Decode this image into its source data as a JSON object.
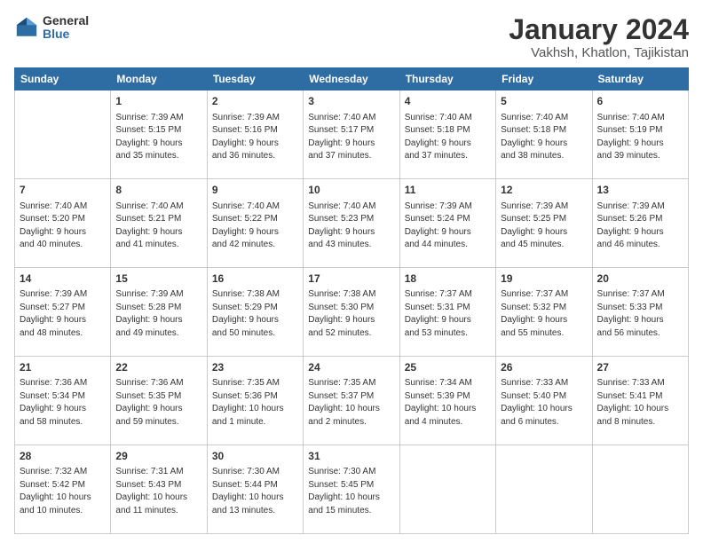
{
  "logo": {
    "general": "General",
    "blue": "Blue"
  },
  "header": {
    "title": "January 2024",
    "subtitle": "Vakhsh, Khatlon, Tajikistan"
  },
  "weekdays": [
    "Sunday",
    "Monday",
    "Tuesday",
    "Wednesday",
    "Thursday",
    "Friday",
    "Saturday"
  ],
  "weeks": [
    [
      {
        "day": "",
        "info": ""
      },
      {
        "day": "1",
        "info": "Sunrise: 7:39 AM\nSunset: 5:15 PM\nDaylight: 9 hours\nand 35 minutes."
      },
      {
        "day": "2",
        "info": "Sunrise: 7:39 AM\nSunset: 5:16 PM\nDaylight: 9 hours\nand 36 minutes."
      },
      {
        "day": "3",
        "info": "Sunrise: 7:40 AM\nSunset: 5:17 PM\nDaylight: 9 hours\nand 37 minutes."
      },
      {
        "day": "4",
        "info": "Sunrise: 7:40 AM\nSunset: 5:18 PM\nDaylight: 9 hours\nand 37 minutes."
      },
      {
        "day": "5",
        "info": "Sunrise: 7:40 AM\nSunset: 5:18 PM\nDaylight: 9 hours\nand 38 minutes."
      },
      {
        "day": "6",
        "info": "Sunrise: 7:40 AM\nSunset: 5:19 PM\nDaylight: 9 hours\nand 39 minutes."
      }
    ],
    [
      {
        "day": "7",
        "info": "Sunrise: 7:40 AM\nSunset: 5:20 PM\nDaylight: 9 hours\nand 40 minutes."
      },
      {
        "day": "8",
        "info": "Sunrise: 7:40 AM\nSunset: 5:21 PM\nDaylight: 9 hours\nand 41 minutes."
      },
      {
        "day": "9",
        "info": "Sunrise: 7:40 AM\nSunset: 5:22 PM\nDaylight: 9 hours\nand 42 minutes."
      },
      {
        "day": "10",
        "info": "Sunrise: 7:40 AM\nSunset: 5:23 PM\nDaylight: 9 hours\nand 43 minutes."
      },
      {
        "day": "11",
        "info": "Sunrise: 7:39 AM\nSunset: 5:24 PM\nDaylight: 9 hours\nand 44 minutes."
      },
      {
        "day": "12",
        "info": "Sunrise: 7:39 AM\nSunset: 5:25 PM\nDaylight: 9 hours\nand 45 minutes."
      },
      {
        "day": "13",
        "info": "Sunrise: 7:39 AM\nSunset: 5:26 PM\nDaylight: 9 hours\nand 46 minutes."
      }
    ],
    [
      {
        "day": "14",
        "info": "Sunrise: 7:39 AM\nSunset: 5:27 PM\nDaylight: 9 hours\nand 48 minutes."
      },
      {
        "day": "15",
        "info": "Sunrise: 7:39 AM\nSunset: 5:28 PM\nDaylight: 9 hours\nand 49 minutes."
      },
      {
        "day": "16",
        "info": "Sunrise: 7:38 AM\nSunset: 5:29 PM\nDaylight: 9 hours\nand 50 minutes."
      },
      {
        "day": "17",
        "info": "Sunrise: 7:38 AM\nSunset: 5:30 PM\nDaylight: 9 hours\nand 52 minutes."
      },
      {
        "day": "18",
        "info": "Sunrise: 7:37 AM\nSunset: 5:31 PM\nDaylight: 9 hours\nand 53 minutes."
      },
      {
        "day": "19",
        "info": "Sunrise: 7:37 AM\nSunset: 5:32 PM\nDaylight: 9 hours\nand 55 minutes."
      },
      {
        "day": "20",
        "info": "Sunrise: 7:37 AM\nSunset: 5:33 PM\nDaylight: 9 hours\nand 56 minutes."
      }
    ],
    [
      {
        "day": "21",
        "info": "Sunrise: 7:36 AM\nSunset: 5:34 PM\nDaylight: 9 hours\nand 58 minutes."
      },
      {
        "day": "22",
        "info": "Sunrise: 7:36 AM\nSunset: 5:35 PM\nDaylight: 9 hours\nand 59 minutes."
      },
      {
        "day": "23",
        "info": "Sunrise: 7:35 AM\nSunset: 5:36 PM\nDaylight: 10 hours\nand 1 minute."
      },
      {
        "day": "24",
        "info": "Sunrise: 7:35 AM\nSunset: 5:37 PM\nDaylight: 10 hours\nand 2 minutes."
      },
      {
        "day": "25",
        "info": "Sunrise: 7:34 AM\nSunset: 5:39 PM\nDaylight: 10 hours\nand 4 minutes."
      },
      {
        "day": "26",
        "info": "Sunrise: 7:33 AM\nSunset: 5:40 PM\nDaylight: 10 hours\nand 6 minutes."
      },
      {
        "day": "27",
        "info": "Sunrise: 7:33 AM\nSunset: 5:41 PM\nDaylight: 10 hours\nand 8 minutes."
      }
    ],
    [
      {
        "day": "28",
        "info": "Sunrise: 7:32 AM\nSunset: 5:42 PM\nDaylight: 10 hours\nand 10 minutes."
      },
      {
        "day": "29",
        "info": "Sunrise: 7:31 AM\nSunset: 5:43 PM\nDaylight: 10 hours\nand 11 minutes."
      },
      {
        "day": "30",
        "info": "Sunrise: 7:30 AM\nSunset: 5:44 PM\nDaylight: 10 hours\nand 13 minutes."
      },
      {
        "day": "31",
        "info": "Sunrise: 7:30 AM\nSunset: 5:45 PM\nDaylight: 10 hours\nand 15 minutes."
      },
      {
        "day": "",
        "info": ""
      },
      {
        "day": "",
        "info": ""
      },
      {
        "day": "",
        "info": ""
      }
    ]
  ]
}
